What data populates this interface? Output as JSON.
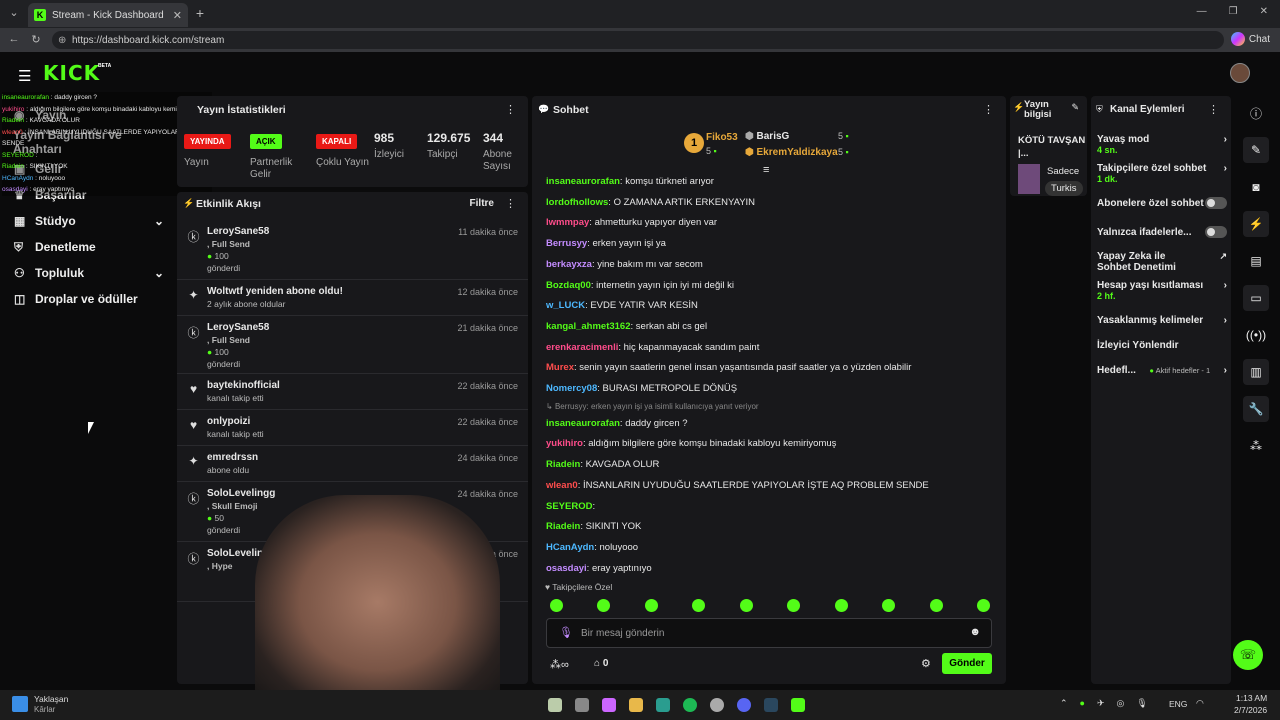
{
  "browser": {
    "tab_title": "Stream - Kick Dashboard",
    "url": "https://dashboard.kick.com/stream",
    "chat_label": "Chat"
  },
  "topnav": {
    "logo": "KICK",
    "beta": "BETA"
  },
  "sidebar": {
    "items": [
      {
        "label": "Yayın",
        "icon": "broadcast-icon"
      },
      {
        "label": "Yayın Bağlantısı ve Anahtarı",
        "icon": "key-icon"
      },
      {
        "label": "Gelir",
        "icon": "money-icon"
      },
      {
        "label": "Başarılar",
        "icon": "trophy-icon"
      },
      {
        "label": "Stüdyo",
        "icon": "studio-icon"
      },
      {
        "label": "Denetleme",
        "icon": "shield-icon"
      },
      {
        "label": "Topluluk",
        "icon": "people-icon"
      },
      {
        "label": "Droplar ve ödüller",
        "icon": "gift-icon"
      }
    ]
  },
  "overlay_chat": [
    {
      "user": "insaneaurorafan",
      "text": "daddy gircen ?"
    },
    {
      "user": "yukihiro",
      "text": "aldığım bilgilere göre komşu binadaki kabloyu kemiriyomuş"
    },
    {
      "user": "Riadein",
      "text": "KAVGADA OLUR"
    },
    {
      "user": "wlean0",
      "text": "İNSANLARIN UYUDUĞU SAATLERDE YAPIYOLAR İŞTE AQ P"
    },
    {
      "user": "SENDE",
      "text": ""
    },
    {
      "user": "SEYEROD",
      "text": ""
    },
    {
      "user": "Riadein",
      "text": "SIKINTI YOK"
    },
    {
      "user": "HCanAydn",
      "text": "noluyooo"
    },
    {
      "user": "osasdayi",
      "text": "eray yaptınıyo"
    }
  ],
  "stats": {
    "title": "Yayın İstatistikleri",
    "items": [
      {
        "badge": "YAYINDA",
        "label": "Yayın",
        "color": "#e91916"
      },
      {
        "badge": "AÇIK",
        "label": "Partnerlik Gelir",
        "color": "#53fc18"
      },
      {
        "badge": "KAPALI",
        "label": "Çoklu Yayın",
        "color": "#e91916"
      },
      {
        "value": "985",
        "label": "İzleyici"
      },
      {
        "value": "129.675",
        "label": "Takipçi"
      },
      {
        "value": "344",
        "label": "Abone Sayısı"
      }
    ]
  },
  "activity": {
    "title": "Etkinlik Akışı",
    "filter": "Filtre",
    "items": [
      {
        "name": "LeroySane58",
        "detail": ", Full Send",
        "amount": "100",
        "sent": "gönderdi",
        "time": "11 dakika önce",
        "icon": "kicks-icon"
      },
      {
        "name": "Woltwtf yeniden abone oldu!",
        "detail": "2 aylık abone oldular",
        "time": "12 dakika önce",
        "icon": "sparkle-icon"
      },
      {
        "name": "LeroySane58",
        "detail": ", Full Send",
        "amount": "100",
        "sent": "gönderdi",
        "time": "21 dakika önce",
        "icon": "kicks-icon"
      },
      {
        "name": "baytekinofficial",
        "detail": "kanalı takip etti",
        "time": "22 dakika önce",
        "icon": "heart-icon"
      },
      {
        "name": "onlypoizi",
        "detail": "kanalı takip etti",
        "time": "22 dakika önce",
        "icon": "heart-icon"
      },
      {
        "name": "emredrssn",
        "detail": "abone oldu",
        "time": "24 dakika önce",
        "icon": "sparkle-icon"
      },
      {
        "name": "SoloLevelingg",
        "detail": ", Skull Emoji",
        "amount": "50",
        "sent": "gönderdi",
        "time": "24 dakika önce",
        "icon": "kicks-icon"
      },
      {
        "name": "SoloLevelingg",
        "detail": ", Hype",
        "time": "5 dakika önce",
        "icon": "kicks-icon"
      }
    ]
  },
  "chat": {
    "title": "Sohbet",
    "top_gifters": [
      {
        "rank": "1",
        "name": "Fiko53",
        "count": "5"
      },
      {
        "name": "BarisG",
        "count": "5"
      },
      {
        "name": "EkremYaldizkaya",
        "count": "5"
      }
    ],
    "messages": [
      {
        "user": "insaneaurorafan",
        "color": "#53fc18",
        "text": "komşu türkneti arıyor"
      },
      {
        "user": "lordofhollows",
        "color": "#53fc18",
        "text": "O ZAMANA ARTIK ERKENYAYIN"
      },
      {
        "user": "lwmmpay",
        "color": "#ff4d8b",
        "text": "ahmetturku yapıyor diyen var"
      },
      {
        "user": "Berrusyy",
        "color": "#c38cff",
        "text": "erken yayın işi ya"
      },
      {
        "user": "berkayxza",
        "color": "#c38cff",
        "text": "yine bakım mı var secom"
      },
      {
        "user": "Bozdaq00",
        "color": "#53fc18",
        "text": "internetin yayın için iyi mi değil ki"
      },
      {
        "user": "w_LUCK",
        "color": "#4db8ff",
        "text": "EVDE YATIR VAR KESİN"
      },
      {
        "user": "kangal_ahmet3162",
        "color": "#53fc18",
        "text": "serkan abi cs gel"
      },
      {
        "user": "erenkaracimenli",
        "color": "#ff4d8b",
        "text": "hiç kapanmayacak sandım paint"
      },
      {
        "user": "Murex",
        "color": "#ff4d4d",
        "text": "senin yayın saatlerin genel insan yaşantısında pasif saatler ya o yüzden olabilir"
      },
      {
        "user": "Nomercy08",
        "color": "#4db8ff",
        "text": "BURASI METROPOLE DÖNÜŞ"
      },
      {
        "reply": "Berrusyy: erken yayın işi ya isimli kullanıcıya yanıt veriyor"
      },
      {
        "user": "insaneaurorafan",
        "color": "#53fc18",
        "text": "daddy gircen ?"
      },
      {
        "user": "yukihiro",
        "color": "#ff4d8b",
        "text": "aldığım bilgilere göre komşu binadaki kabloyu kemiriyomuş"
      },
      {
        "user": "Riadein",
        "color": "#53fc18",
        "text": "KAVGADA OLUR"
      },
      {
        "user": "wlean0",
        "color": "#ff4d4d",
        "text": "İNSANLARIN UYUDUĞU SAATLERDE YAPIYOLAR İŞTE AQ PROBLEM SENDE"
      },
      {
        "user": "SEYEROD",
        "color": "#53fc18",
        "text": ""
      },
      {
        "user": "Riadein",
        "color": "#53fc18",
        "text": "SIKINTI YOK"
      },
      {
        "user": "HCanAydn",
        "color": "#4db8ff",
        "text": "noluyooo"
      },
      {
        "user": "osasdayi",
        "color": "#c38cff",
        "text": "eray yaptınıyo"
      }
    ],
    "followers_only": "Takipçilere Özel",
    "input_placeholder": "Bir mesaj gönderin",
    "points": "0",
    "send": "Gönder"
  },
  "stream_info": {
    "title": "Yayın bilgisi",
    "name": "KÖTÜ TAVŞAN |...",
    "category": "Sadece",
    "tag": "Turkis"
  },
  "channel_actions": {
    "title": "Kanal Eylemleri",
    "items": [
      {
        "label": "Yavaş mod",
        "value": "4 sn."
      },
      {
        "label": "Takipçilere özel sohbet",
        "value": "1 dk."
      },
      {
        "label": "Abonelere özel sohbet",
        "value": ""
      },
      {
        "label": "Yalnızca ifadelerle...",
        "value": ""
      },
      {
        "label": "Yapay Zeka ile Sohbet Denetimi",
        "value": ""
      },
      {
        "label": "Hesap yaşı kısıtlaması",
        "value": "2 hf."
      },
      {
        "label": "Yasaklanmış kelimeler",
        "value": ""
      },
      {
        "label": "İzleyici Yönlendir",
        "value": ""
      },
      {
        "label": "Hedefl...",
        "value": "Aktif hedefler - 1"
      }
    ]
  },
  "taskbar": {
    "weather": "Yaklaşan",
    "weather_sub": "Kârlar",
    "lang": "ENG",
    "time": "1:13 AM",
    "date": "2/7/2026"
  }
}
